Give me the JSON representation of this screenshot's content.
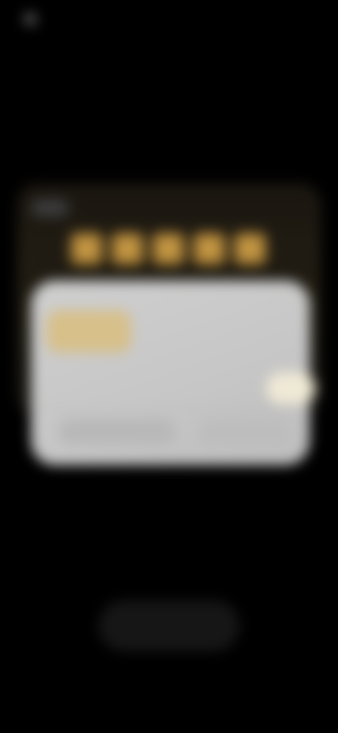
{
  "status_bar": {
    "left_text": "",
    "right_text": ""
  },
  "header": {
    "title": ""
  },
  "rating_card": {
    "badge": "",
    "stars": [
      "★",
      "★",
      "★",
      "★",
      "★"
    ]
  },
  "dialog": {
    "title": "",
    "body": "",
    "left_button": "",
    "right_button": ""
  },
  "bottom": {
    "button_label": ""
  },
  "colors": {
    "background": "#000000",
    "star": "#b3883b",
    "dialog": "#c9c9c9"
  }
}
